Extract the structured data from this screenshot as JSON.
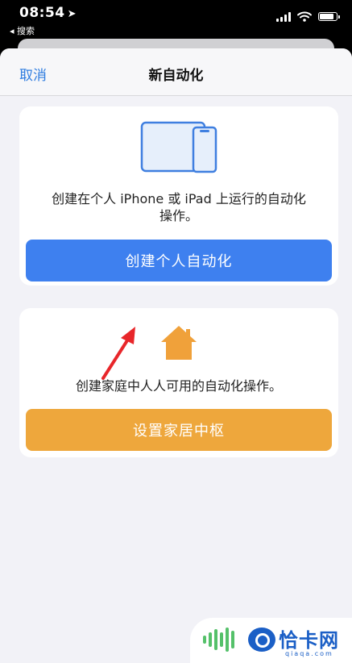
{
  "status_bar": {
    "time": "08:54",
    "location_glyph": "➤",
    "back_label": "◂ 搜索"
  },
  "nav": {
    "cancel_label": "取消",
    "title": "新自动化"
  },
  "personal": {
    "description_line1": "创建在个人 iPhone 或 iPad 上运行的自动化",
    "description_line2": "操作。",
    "button_label": "创建个人自动化",
    "icon": "iphone-ipad-icon"
  },
  "home": {
    "description": "创建家庭中人人可用的自动化操作。",
    "button_label": "设置家居中枢",
    "icon": "home-icon"
  },
  "watermark": {
    "brand": "恰卡网",
    "domain": "qiaqa.com"
  },
  "colors": {
    "accent_blue": "#3e80ef",
    "home_orange": "#eea73c",
    "link_blue": "#2f7de0",
    "annotation_red": "#e8262a"
  }
}
